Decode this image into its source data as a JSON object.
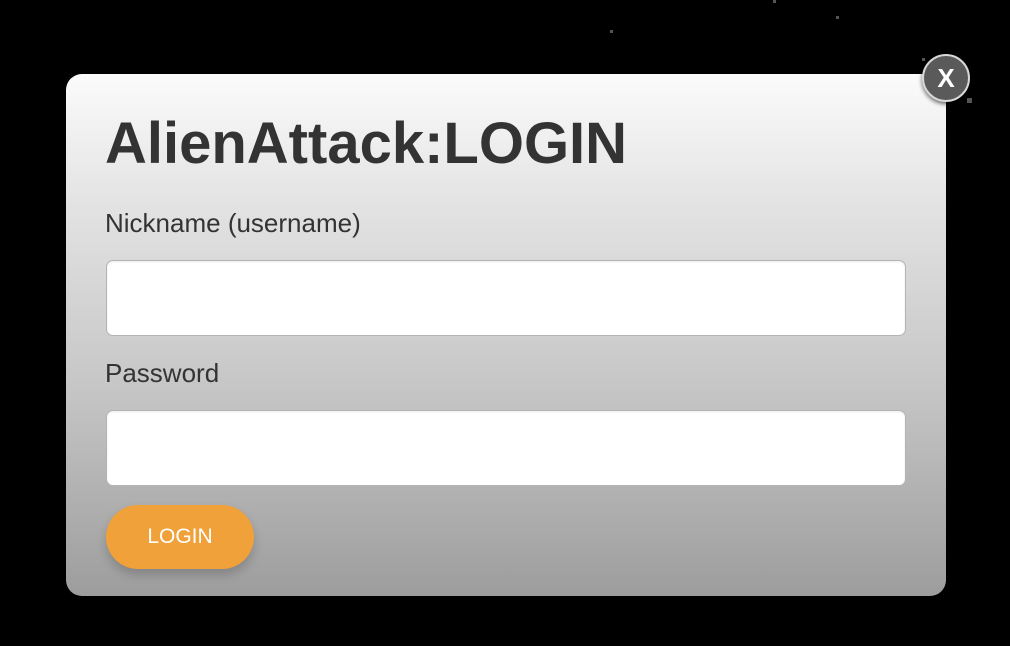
{
  "dialog": {
    "title": "AlienAttack:LOGIN",
    "close_label": "X",
    "username": {
      "label": "Nickname (username)",
      "value": "",
      "placeholder": ""
    },
    "password": {
      "label": "Password",
      "value": "",
      "placeholder": ""
    },
    "login_label": "LOGIN"
  },
  "colors": {
    "background": "#000000",
    "accent": "#f0a13a",
    "text": "#333333",
    "close_button": "#5a5a5a"
  }
}
